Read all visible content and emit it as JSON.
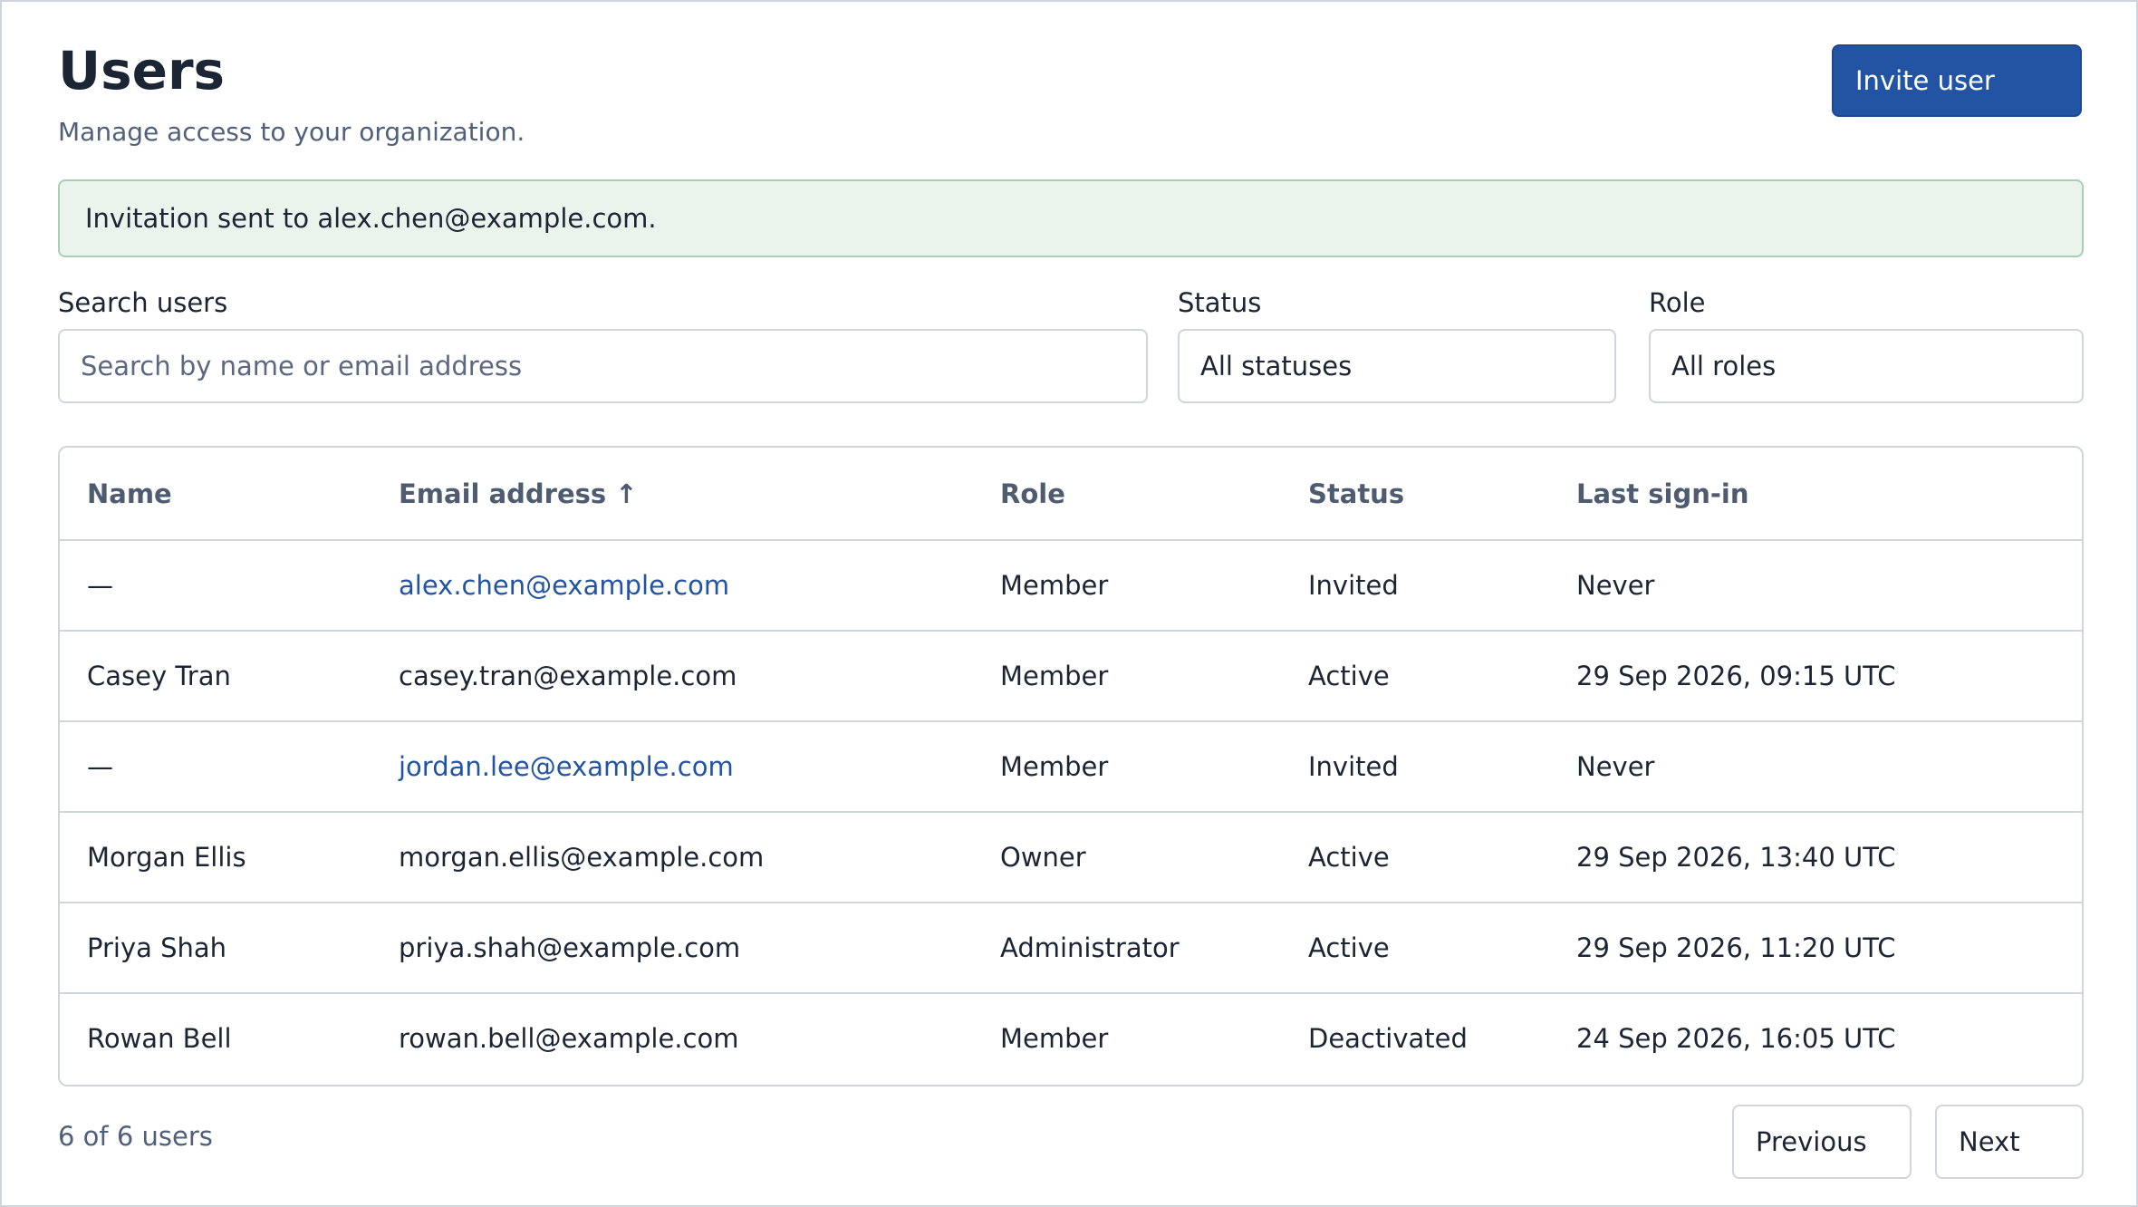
{
  "header": {
    "title": "Users",
    "subtitle": "Manage access to your organization.",
    "invite_label": "Invite user"
  },
  "alert": {
    "message": "Invitation sent to alex.chen@example.com."
  },
  "filters": {
    "search_label": "Search users",
    "search_placeholder": "Search by name or email address",
    "search_value": "",
    "status_label": "Status",
    "status_value": "All statuses",
    "role_label": "Role",
    "role_value": "All roles"
  },
  "table": {
    "columns": [
      "Name",
      "Email address ↑",
      "Role",
      "Status",
      "Last sign-in"
    ],
    "rows": [
      {
        "name": "—",
        "email": "alex.chen@example.com",
        "email_link": true,
        "role": "Member",
        "status": "Invited",
        "last_sign_in": "Never"
      },
      {
        "name": "Casey Tran",
        "email": "casey.tran@example.com",
        "email_link": false,
        "role": "Member",
        "status": "Active",
        "last_sign_in": "29 Sep 2026, 09:15 UTC"
      },
      {
        "name": "—",
        "email": "jordan.lee@example.com",
        "email_link": true,
        "role": "Member",
        "status": "Invited",
        "last_sign_in": "Never"
      },
      {
        "name": "Morgan Ellis",
        "email": "morgan.ellis@example.com",
        "email_link": false,
        "role": "Owner",
        "status": "Active",
        "last_sign_in": "29 Sep 2026, 13:40 UTC"
      },
      {
        "name": "Priya Shah",
        "email": "priya.shah@example.com",
        "email_link": false,
        "role": "Administrator",
        "status": "Active",
        "last_sign_in": "29 Sep 2026, 11:20 UTC"
      },
      {
        "name": "Rowan Bell",
        "email": "rowan.bell@example.com",
        "email_link": false,
        "role": "Member",
        "status": "Deactivated",
        "last_sign_in": "24 Sep 2026, 16:05 UTC"
      }
    ]
  },
  "footer": {
    "count_text": "6 of 6 users",
    "previous_label": "Previous",
    "next_label": "Next"
  },
  "colors": {
    "primary": "#2354a4",
    "alert_background": "#ebf3ed",
    "alert_border": "#a9cfb2",
    "text": "#1c2533",
    "muted_text": "#51607a",
    "border": "#d0d4dc"
  }
}
